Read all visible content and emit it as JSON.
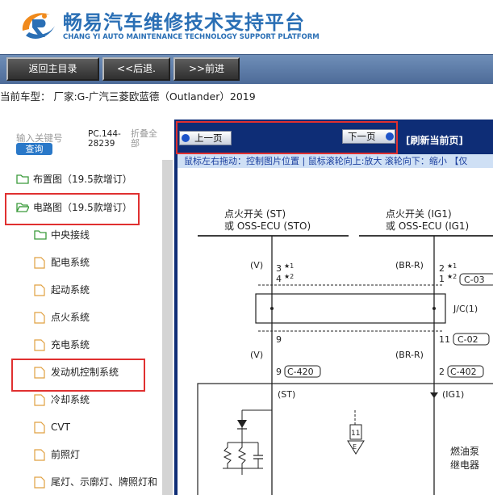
{
  "header": {
    "title": "畅易汽车维修技术支持平台",
    "subtitle": "CHANG YI AUTO MAINTENANCE TECHNOLOGY SUPPORT PLATFORM",
    "logo_icon": "cy-logo-icon"
  },
  "nav": {
    "home_label": "返回主目录",
    "back_label": "<<后退.",
    "forward_label": ">>前进"
  },
  "model_info": "当前车型： 厂家:G-广汽三菱欧蓝德（Outlander）2019",
  "sidebar": {
    "search_placeholder": "输入关键号",
    "search_button": "查询",
    "pc_code": "PC.144-28239",
    "collapse_all": "折叠全部",
    "items": [
      {
        "label": "布置图（19.5款增订）",
        "icon": "folder-icon"
      },
      {
        "label": "电路图（19.5款增订）",
        "icon": "folder-open-icon"
      },
      {
        "label": "中央接线",
        "icon": "folder-icon"
      },
      {
        "label": "配电系统",
        "icon": "document-icon"
      },
      {
        "label": "起动系统",
        "icon": "document-icon"
      },
      {
        "label": "点火系统",
        "icon": "document-icon"
      },
      {
        "label": "充电系统",
        "icon": "document-icon"
      },
      {
        "label": "发动机控制系统",
        "icon": "document-icon"
      },
      {
        "label": "冷却系统",
        "icon": "document-icon"
      },
      {
        "label": "CVT",
        "icon": "document-icon"
      },
      {
        "label": "前照灯",
        "icon": "document-icon"
      },
      {
        "label": "尾灯、示廓灯、牌照灯和",
        "icon": "document-icon"
      }
    ]
  },
  "viewer": {
    "prev_label": "上一页",
    "next_label": "下一页",
    "refresh_label": "[刷新当前页]",
    "hint": "鼠标左右拖动：控制图片位置 | 鼠标滚轮向上:放大  滚轮向下：缩小 【仅"
  },
  "diagram": {
    "left_title_1": "点火开关 (ST)",
    "left_title_2": "或 OSS-ECU (STO)",
    "right_title_1": "点火开关 (IG1)",
    "right_title_2": "或 OSS-ECU (IG1)",
    "left_wire_color": "(V)",
    "right_wire_color": "(BR-R)",
    "left_pin_a": "3",
    "left_pin_b": "4",
    "right_pin_a": "2",
    "right_pin_b": "1",
    "star1": "★1",
    "star2": "★2",
    "right_conn_top": "C-03",
    "jc_label": "J/C(1)",
    "left_jc_pin": "9",
    "right_jc_pin": "11",
    "right_jc_conn": "C-02",
    "left_wire_color_2": "(V)",
    "right_wire_color_2": "(BR-R)",
    "left_ecu_pin": "9",
    "left_ecu_conn": "C-420",
    "right_ecu_pin": "2",
    "right_ecu_conn": "C-402",
    "left_signal": "(ST)",
    "right_signal": "(IG1)",
    "ground_pin": "11",
    "ground_letter": "E",
    "relay_label_1": "燃油泵",
    "relay_label_2": "继电器"
  },
  "colors": {
    "nav_bar": "#4d6b98",
    "viewer_bg": "#0e2d76",
    "highlight": "#e03030",
    "hint_bg": "#cfe0f5",
    "search_button": "#2a78c8"
  }
}
